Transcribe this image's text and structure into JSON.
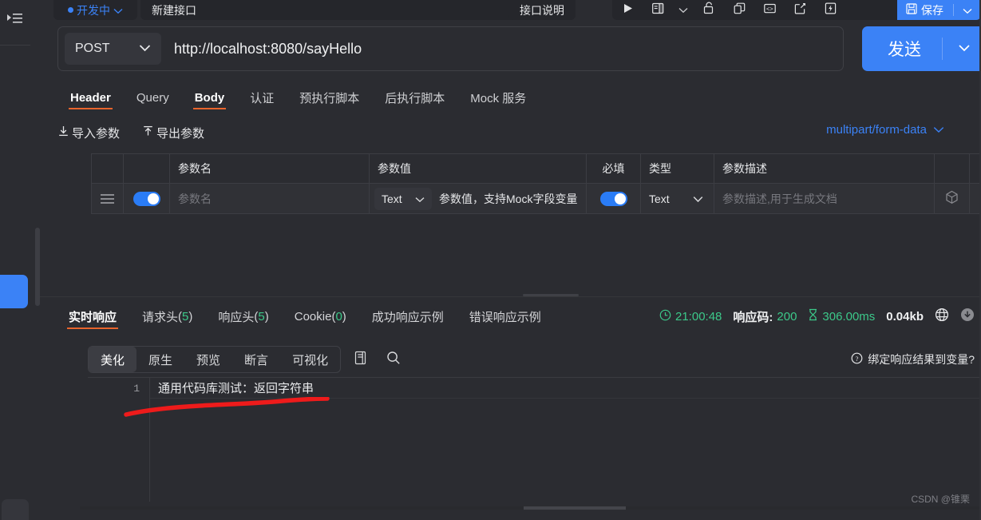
{
  "sidebar": {
    "menu_icon": "menu-expand-icon"
  },
  "top_tabs": {
    "status_label": "开发中",
    "api_name": "新建接口",
    "api_desc_label": "接口说明"
  },
  "toolbar": {
    "icons": [
      "run-icon",
      "layout-icon",
      "chevron-down-icon",
      "unlock-icon",
      "copy-icon",
      "code-icon",
      "share-icon",
      "lightning-icon"
    ],
    "save_label": "保存"
  },
  "url_bar": {
    "method": "POST",
    "url": "http://localhost:8080/sayHello",
    "send_label": "发送"
  },
  "request_tabs": [
    {
      "label": "Header",
      "active": false
    },
    {
      "label": "Query",
      "active": false
    },
    {
      "label": "Body",
      "active": true
    },
    {
      "label": "认证",
      "active": false
    },
    {
      "label": "预执行脚本",
      "active": false
    },
    {
      "label": "后执行脚本",
      "active": false
    },
    {
      "label": "Mock 服务",
      "active": false
    }
  ],
  "params_toolbar": {
    "import_label": "导入参数",
    "export_label": "导出参数",
    "content_type": "multipart/form-data"
  },
  "params_table": {
    "columns": [
      "",
      "",
      "参数名",
      "参数值",
      "必填",
      "类型",
      "参数描述",
      "",
      ""
    ],
    "rows": [
      {
        "enabled": true,
        "name_placeholder": "参数名",
        "value_type": "Text",
        "value_placeholder": "参数值，支持Mock字段变量",
        "required": true,
        "type": "Text",
        "desc_placeholder": "参数描述,用于生成文档"
      }
    ]
  },
  "response_tabs": [
    {
      "label": "实时响应",
      "count": null,
      "active": true
    },
    {
      "label": "请求头",
      "count": "5",
      "active": false
    },
    {
      "label": "响应头",
      "count": "5",
      "active": false
    },
    {
      "label": "Cookie",
      "count": "0",
      "active": false
    },
    {
      "label": "成功响应示例",
      "count": null,
      "active": false
    },
    {
      "label": "错误响应示例",
      "count": null,
      "active": false
    }
  ],
  "status_bar": {
    "time": "21:00:48",
    "code_label": "响应码:",
    "code_value": "200",
    "duration": "306.00ms",
    "size": "0.04kb"
  },
  "format_bar": {
    "items": [
      {
        "label": "美化",
        "active": true
      },
      {
        "label": "原生",
        "active": false
      },
      {
        "label": "预览",
        "active": false
      },
      {
        "label": "断言",
        "active": false
      },
      {
        "label": "可视化",
        "active": false
      }
    ],
    "bind_variable_label": "绑定响应结果到变量?"
  },
  "response_body": {
    "line_number": "1",
    "line_text": "通用代码库测试：返回字符串"
  },
  "watermark": "CSDN @锥栗",
  "colors": {
    "background": "#2b2c31",
    "panel": "#25262b",
    "accent_blue": "#3b82f6",
    "accent_orange": "#e8642c",
    "green": "#3cc98a",
    "annotation_red": "#ee1b1b"
  }
}
